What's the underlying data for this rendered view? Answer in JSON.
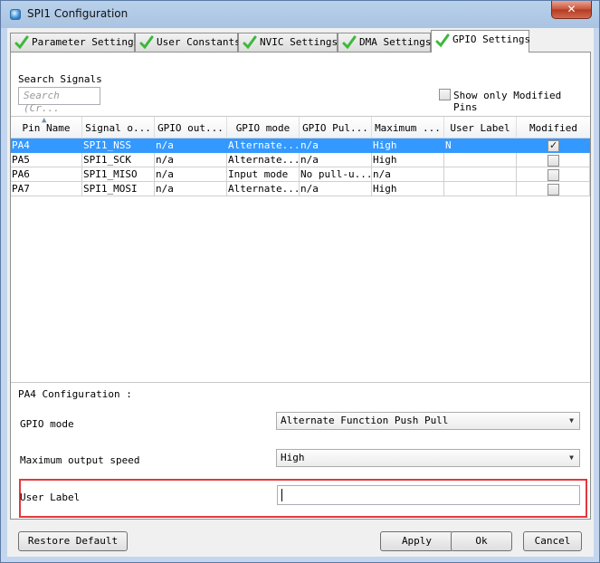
{
  "window": {
    "title": "SPI1 Configuration",
    "close_glyph": "✕"
  },
  "tabs": [
    {
      "label": "Parameter Settings",
      "icon": "check-icon"
    },
    {
      "label": "User Constants",
      "icon": "check-icon"
    },
    {
      "label": "NVIC Settings",
      "icon": "check-icon"
    },
    {
      "label": "DMA Settings",
      "icon": "check-icon"
    },
    {
      "label": "GPIO Settings",
      "icon": "check-icon",
      "active": true
    }
  ],
  "search": {
    "label": "Search Signals",
    "placeholder": "Search (Cr..."
  },
  "show_modified": {
    "label": "Show only Modified Pins",
    "checked": false
  },
  "table": {
    "columns": [
      "Pin Name",
      "Signal o...",
      "GPIO out...",
      "GPIO mode",
      "GPIO Pul...",
      "Maximum ...",
      "User Label",
      "Modified"
    ],
    "rows": [
      {
        "pin": "PA4",
        "signal": "SPI1_NSS",
        "output": "n/a",
        "mode": "Alternate...",
        "pull": "n/a",
        "speed": "High",
        "user_label": "N",
        "modified": true,
        "selected": true
      },
      {
        "pin": "PA5",
        "signal": "SPI1_SCK",
        "output": "n/a",
        "mode": "Alternate...",
        "pull": "n/a",
        "speed": "High",
        "user_label": "",
        "modified": false,
        "selected": false
      },
      {
        "pin": "PA6",
        "signal": "SPI1_MISO",
        "output": "n/a",
        "mode": "Input mode",
        "pull": "No pull-u...",
        "speed": "n/a",
        "user_label": "",
        "modified": false,
        "selected": false
      },
      {
        "pin": "PA7",
        "signal": "SPI1_MOSI",
        "output": "n/a",
        "mode": "Alternate...",
        "pull": "n/a",
        "speed": "High",
        "user_label": "",
        "modified": false,
        "selected": false
      }
    ]
  },
  "config": {
    "group_title": "PA4 Configuration :",
    "gpio_mode_label": "GPIO mode",
    "gpio_mode_value": "Alternate Function Push Pull",
    "speed_label": "Maximum output speed",
    "speed_value": "High",
    "user_label_label": "User Label",
    "user_label_value": ""
  },
  "buttons": {
    "restore": "Restore Default",
    "apply": "Apply",
    "ok": "Ok",
    "cancel": "Cancel"
  },
  "colors": {
    "selection": "#3399ff",
    "highlight_border": "#e3383c",
    "check_green": "#3db83a"
  }
}
